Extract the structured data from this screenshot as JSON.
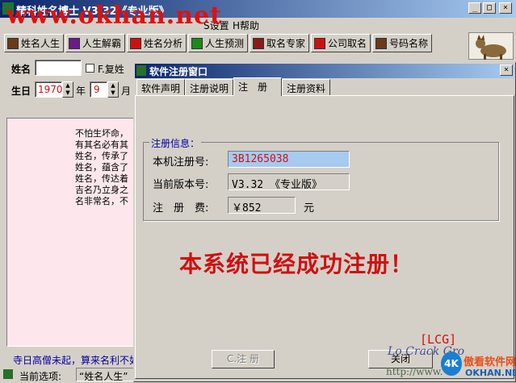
{
  "main_window": {
    "title": "精科姓名博士 V3.32《专业版》",
    "watermark": "www.okhan.net",
    "controls": {
      "minimize": "_",
      "maximize": "□",
      "close": "×"
    }
  },
  "menubar": {
    "items": [
      {
        "label": "S设置"
      },
      {
        "label": "H帮助"
      }
    ]
  },
  "toolbar": {
    "buttons": [
      {
        "label": "姓名人生",
        "icon": "book-icon",
        "color": "#6a3a1a"
      },
      {
        "label": "人生解霸",
        "icon": "cube-icon",
        "color": "#6a1a8a"
      },
      {
        "label": "姓名分析",
        "icon": "book-open-icon",
        "color": "#d01010"
      },
      {
        "label": "人生预测",
        "icon": "cube-icon",
        "color": "#1a8a1a"
      },
      {
        "label": "取名专家",
        "icon": "book-icon",
        "color": "#8a1a1a"
      },
      {
        "label": "公司取名",
        "icon": "gem-icon",
        "color": "#d01010"
      },
      {
        "label": "号码名称",
        "icon": "book-icon",
        "color": "#6a3a1a"
      }
    ]
  },
  "form": {
    "name_label": "姓名",
    "fuxing_label": "F.复姓",
    "birth_label": "生日",
    "year_value": "1970",
    "year_unit": "年",
    "month_value": "9",
    "month_unit": "月"
  },
  "text_panel": {
    "lines": [
      "不怕生坏命，",
      "有其名必有其",
      "姓名，传承了",
      "姓名，蕴含了",
      "姓名，传达着",
      "吉名乃立身之",
      "名非常名，不"
    ]
  },
  "status": {
    "footer_text": "寺日高僧未起，算来名利不如",
    "current_option_label": "当前选项:",
    "current_option_value": "“姓名人生”"
  },
  "dialog": {
    "title": "软件注册窗口",
    "close": "×",
    "tabs": [
      {
        "label": "软件声明",
        "active": false
      },
      {
        "label": "注册说明",
        "active": false
      },
      {
        "label": "注　册",
        "active": true
      },
      {
        "label": "注册资料",
        "active": false
      }
    ],
    "group_title": "注册信息：",
    "fields": [
      {
        "label": "本机注册号:",
        "value": "3B1265038"
      },
      {
        "label": "当前版本号:",
        "value": "V3.32 《专业版》"
      },
      {
        "label": "注　册　费:",
        "value": "￥852",
        "unit": "元"
      }
    ],
    "success_message": "本系统已经成功注册！",
    "register_button": "C.注 册",
    "close_button": "关闭"
  },
  "signature": {
    "tag": "[LCG]",
    "sign": "Lo Crack Gro",
    "url": "http://www."
  },
  "site_logo": {
    "badge": "4K",
    "name": "傲看软件网",
    "domain": "OKHAN.NET"
  }
}
